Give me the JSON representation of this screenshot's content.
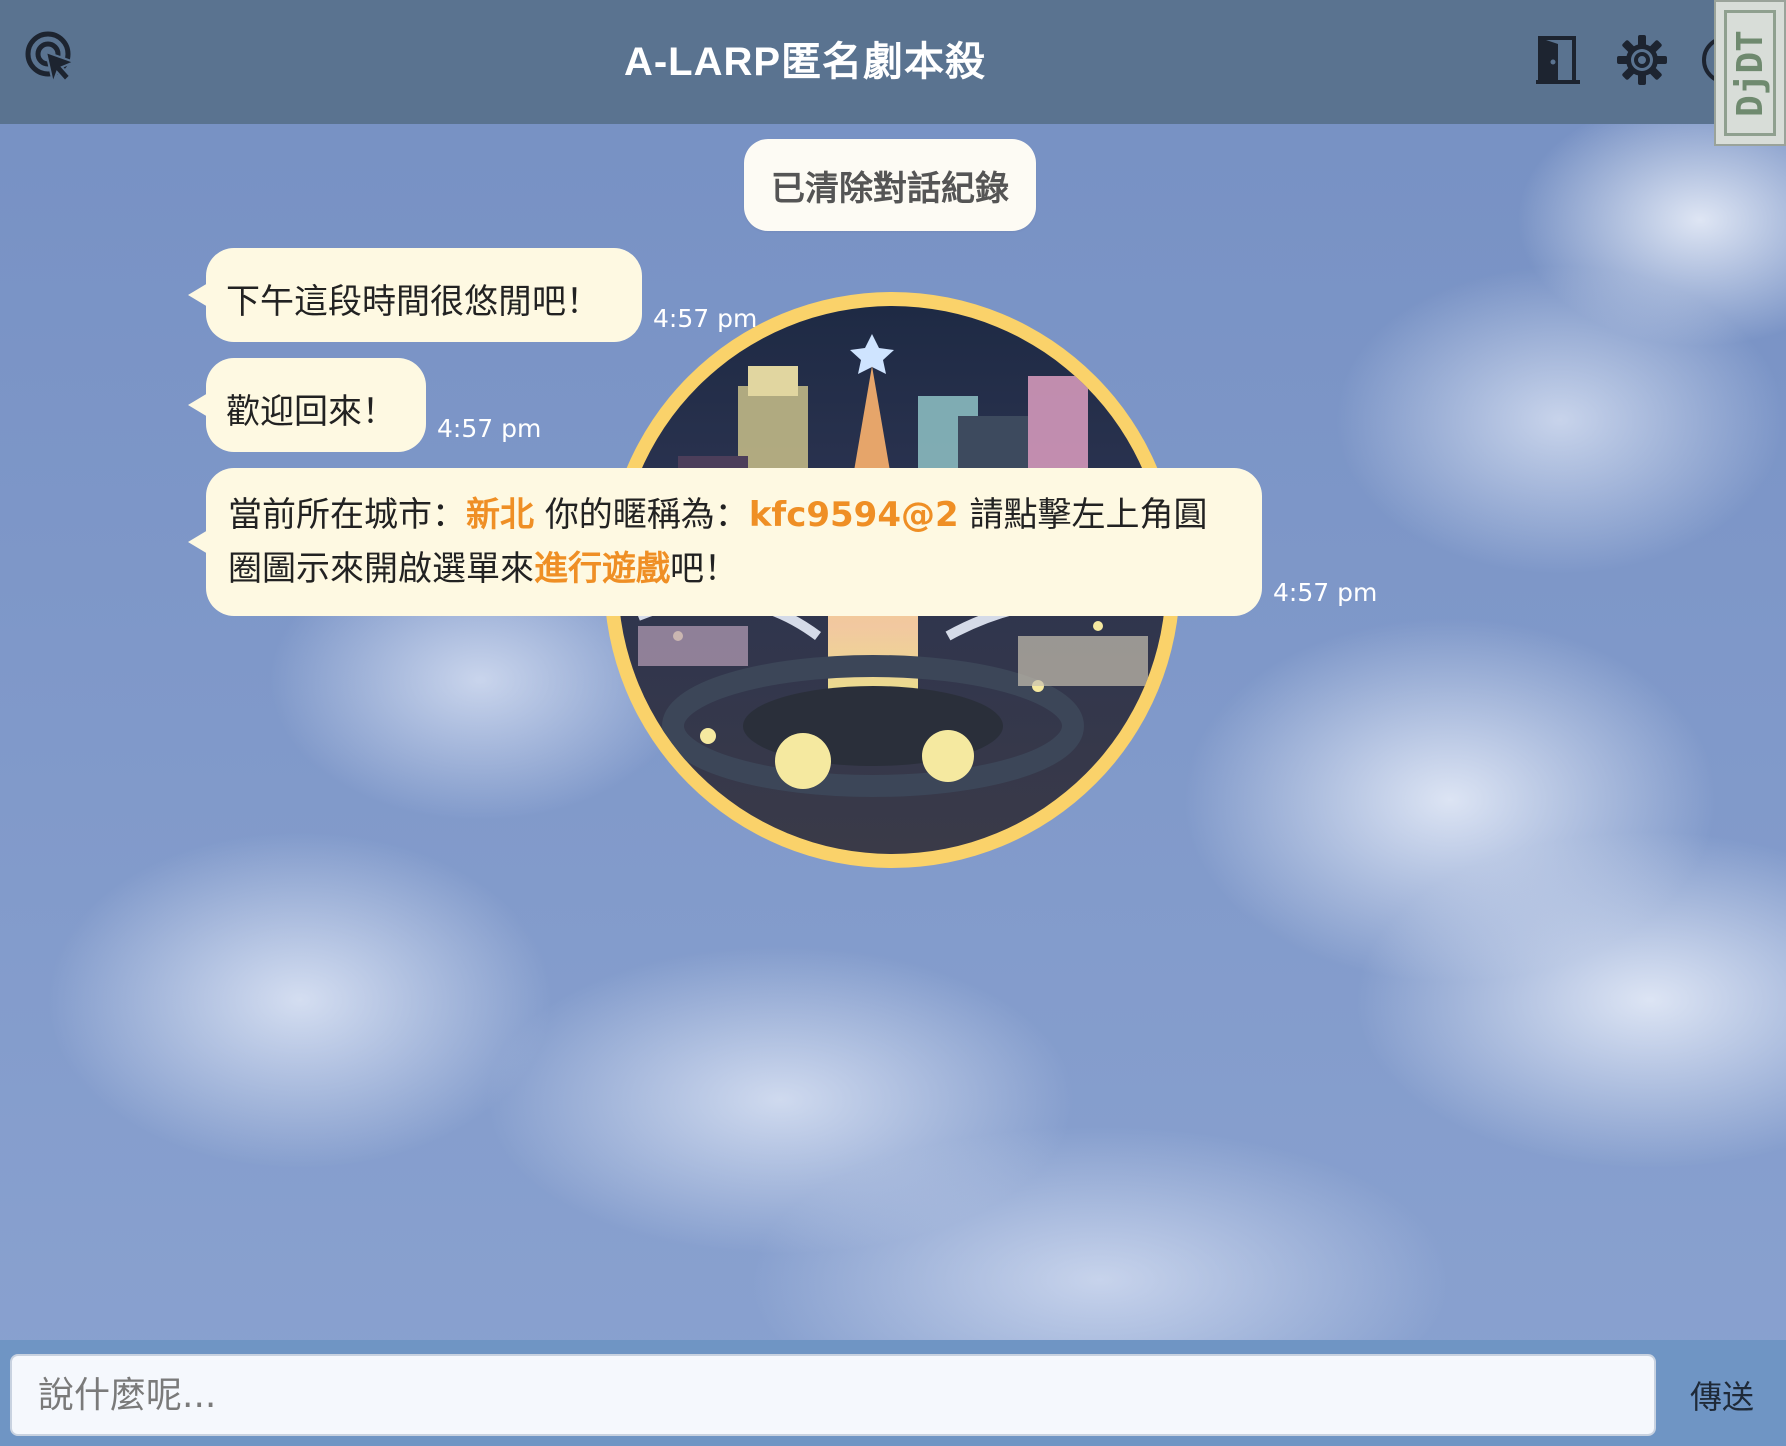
{
  "header": {
    "title": "A-LARP匿名劇本殺",
    "menu_icon": "cursor-click-icon",
    "exit_icon": "door-exit-icon",
    "settings_icon": "gear-icon",
    "profile_icon": "user-circle-icon",
    "debug_tab_label": "DjDT",
    "bg_color": "#5a7390"
  },
  "chat": {
    "system_message": "已清除對話紀錄",
    "messages": [
      {
        "text": "下午這段時間很悠閒吧！",
        "time": "4:57 pm"
      },
      {
        "text": "歡迎回來！",
        "time": "4:57 pm"
      },
      {
        "line1_prefix": "當前所在城市：",
        "city": "新北",
        "nickname_label": "你的暱稱為：",
        "nickname": "kfc9594@2",
        "line1_suffix": "請點擊左上角圓",
        "line2_prefix": "圈圖示來開啟選單來",
        "action": "進行遊戲",
        "line2_suffix": "吧！",
        "time": "4:57 pm"
      }
    ],
    "bubble_color": "#fef9e2",
    "highlight_color": "#ef8f25",
    "image_alt": "city-plaza-night-image"
  },
  "composer": {
    "placeholder": "說什麼呢...",
    "value": "",
    "send_label": "傳送"
  }
}
